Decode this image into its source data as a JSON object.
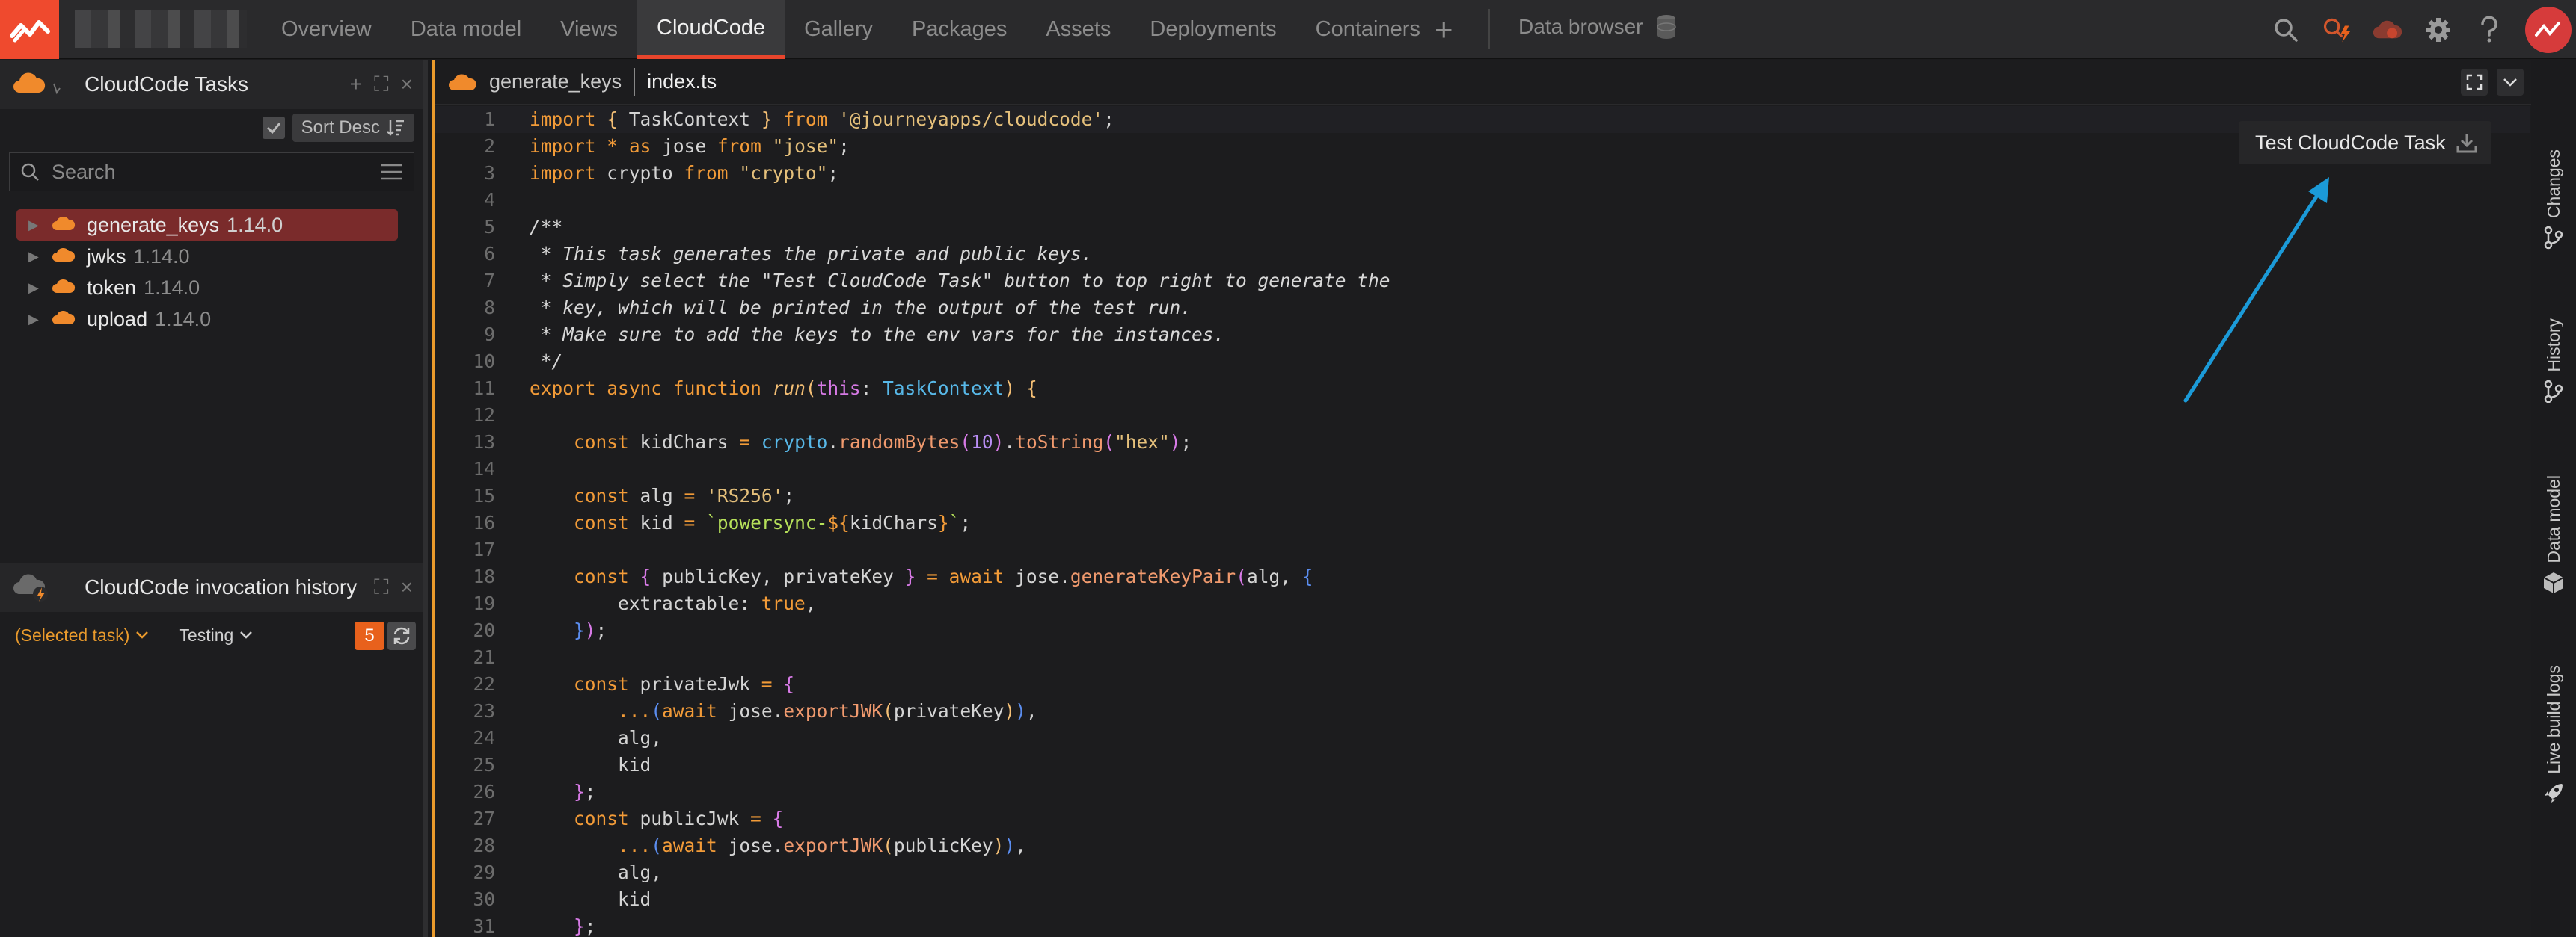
{
  "topbar": {
    "nav": [
      "Overview",
      "Data model",
      "Views",
      "CloudCode",
      "Gallery",
      "Packages",
      "Assets",
      "Deployments",
      "Containers"
    ],
    "active_tab": "CloudCode",
    "add_label": "+",
    "data_browser": "Data browser"
  },
  "tasks_panel": {
    "title": "CloudCode Tasks",
    "sort_label": "Sort Desc",
    "search_placeholder": "Search",
    "tasks": [
      {
        "name": "generate_keys",
        "version": "1.14.0",
        "selected": true
      },
      {
        "name": "jwks",
        "version": "1.14.0",
        "selected": false
      },
      {
        "name": "token",
        "version": "1.14.0",
        "selected": false
      },
      {
        "name": "upload",
        "version": "1.14.0",
        "selected": false
      }
    ]
  },
  "history_panel": {
    "title": "CloudCode invocation history",
    "selected_filter": "(Selected task)",
    "environment": "Testing",
    "count": "5"
  },
  "editor": {
    "task_name": "generate_keys",
    "file_name": "index.ts",
    "test_button": "Test CloudCode Task",
    "line_numbers": [
      "1",
      "2",
      "3",
      "4",
      "5",
      "6",
      "7",
      "8",
      "9",
      "10",
      "11",
      "12",
      "13",
      "14",
      "15",
      "16",
      "17",
      "18",
      "19",
      "20",
      "21",
      "22",
      "23",
      "24",
      "25",
      "26",
      "27",
      "28",
      "29",
      "30",
      "31"
    ]
  },
  "right_sidebar": [
    "Changes",
    "History",
    "Data model",
    "Live build logs"
  ],
  "colors": {
    "accent": "#e8452c",
    "selected_task": "#7a2b2b",
    "annotation_arrow": "#1b9ad8"
  }
}
